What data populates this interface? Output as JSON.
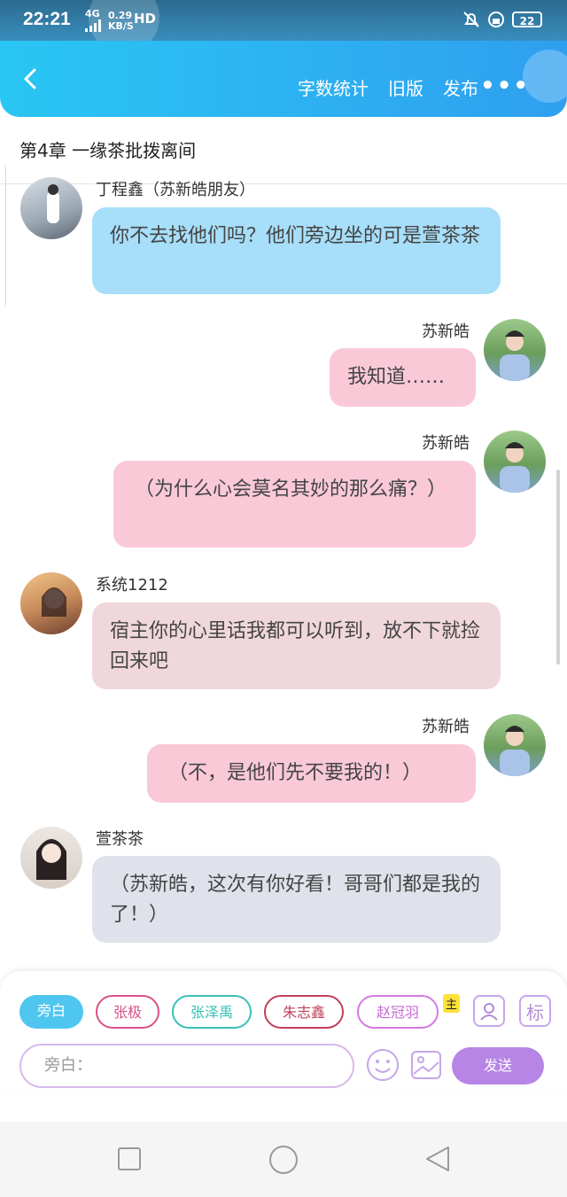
{
  "status_bar": {
    "time": "22:21",
    "network": "4G",
    "speed_value": "0.29",
    "speed_unit": "KB/S",
    "hd": "HD",
    "battery": "22"
  },
  "header": {
    "back_icon": "chevron-left-icon",
    "actions": [
      "字数统计",
      "旧版",
      "发布"
    ],
    "more": "•••"
  },
  "chapter_title": "第4章 一缘茶批拨离间",
  "messages": [
    {
      "speaker": "丁程鑫（苏新皓朋友）",
      "text": "你不去找他们吗？他们旁边坐的可是萱茶茶",
      "side": "left",
      "color": "#a7def9"
    },
    {
      "speaker": "苏新皓",
      "text": "我知道……",
      "side": "right",
      "color": "#f9c9d7"
    },
    {
      "speaker": "苏新皓",
      "text": "（为什么心会莫名其妙的那么痛？）",
      "side": "right",
      "color": "#f9c9d7"
    },
    {
      "speaker": "系统1212",
      "text": "宿主你的心里话我都可以听到，放不下就捡回来吧",
      "side": "left",
      "color": "#f0d7dc"
    },
    {
      "speaker": "苏新皓",
      "text": "（不，是他们先不要我的！）",
      "side": "right",
      "color": "#f9c9d7"
    },
    {
      "speaker": "萱茶茶",
      "text": "（苏新皓，这次有你好看！哥哥们都是我的了！）",
      "side": "left",
      "color": "#dfe2ea"
    }
  ],
  "footer": {
    "roles": [
      {
        "label": "旁白",
        "selected": true
      },
      {
        "label": "张极",
        "selected": false
      },
      {
        "label": "张泽禹",
        "selected": false
      },
      {
        "label": "朱志鑫",
        "selected": false
      },
      {
        "label": "赵冠羽",
        "selected": false
      }
    ],
    "main_badge": "主",
    "label_button": "标",
    "input_placeholder": "旁白：",
    "send_label": "发送"
  },
  "nav": {
    "icons": [
      "square-icon",
      "circle-icon",
      "triangle-back-icon"
    ]
  }
}
